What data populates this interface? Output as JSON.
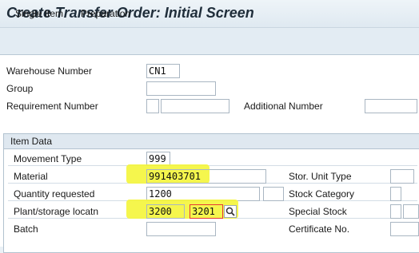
{
  "header": {
    "title": "Create Transfer Order: Initial Screen"
  },
  "toolbar": {
    "single_item": "Single Item",
    "preparation": "Preparation"
  },
  "form": {
    "warehouse_number": {
      "label": "Warehouse Number",
      "value": "CN1"
    },
    "group": {
      "label": "Group",
      "value": ""
    },
    "requirement_number": {
      "label": "Requirement Number",
      "value": ""
    },
    "additional_number": {
      "label": "Additional Number",
      "value": ""
    }
  },
  "item_data": {
    "heading": "Item Data",
    "movement_type": {
      "label": "Movement Type",
      "value": "999"
    },
    "material": {
      "label": "Material",
      "value": "991403701"
    },
    "quantity_requested": {
      "label": "Quantity requested",
      "value": "1200"
    },
    "plant_storage": {
      "label": "Plant/storage locatn",
      "plant": "3200",
      "storage": "3201"
    },
    "batch": {
      "label": "Batch",
      "value": ""
    },
    "stor_unit_type": {
      "label": "Stor. Unit Type"
    },
    "stock_category": {
      "label": "Stock Category"
    },
    "special_stock": {
      "label": "Special Stock"
    },
    "certificate_no": {
      "label": "Certificate No."
    }
  },
  "colors": {
    "highlight": "#f4f53a",
    "accent_red": "#e53935"
  }
}
